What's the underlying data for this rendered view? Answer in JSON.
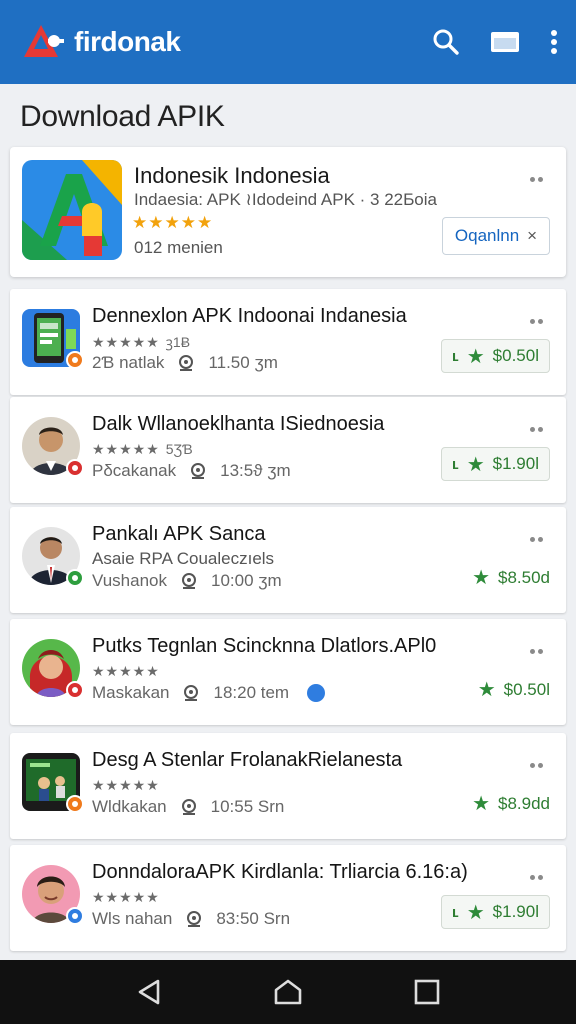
{
  "app": {
    "name": "firdonak"
  },
  "page": {
    "title": "Download APIK"
  },
  "featured": {
    "name": "Indonesik Indonesia",
    "subtitle": "Indaesia: APK ≀Idodeind APK · 3 22Ƃoia",
    "stars": "★★★★★",
    "count": "012 menien",
    "button_label": "Oqanlnn",
    "button_close": "×"
  },
  "items": [
    {
      "title": "Dennexlon APK Indoonai Indanesia",
      "stars": "★★★★★",
      "stars_sub": "ꝫ1Ƀ",
      "meta_left": "2Ɓ natlak",
      "meta_time": "11.50 ʒm",
      "price": "$0.50l",
      "price_style": "button",
      "badge_color": "#f07a1c",
      "avatar_kind": "phone"
    },
    {
      "title": "Dalk Wllanoeklhanta ISiednoesia",
      "stars": "★★★★★",
      "stars_sub": "5ƷƁ",
      "meta_left": "Pδcakanak",
      "meta_time": "13:5ϑ ʒm",
      "price": "$1.90l",
      "price_style": "button",
      "badge_color": "#d93030",
      "avatar_kind": "man"
    },
    {
      "title": "Pankalı APK Sanca",
      "subtitle": "Asaie RPA Coualeczıels",
      "meta_left": "Vushanok",
      "meta_time": "10:00 ʒm",
      "price": "$8.50d",
      "price_style": "plain",
      "badge_color": "#2e9e3e",
      "avatar_kind": "suit"
    },
    {
      "title": "Putks Tegnlan Scincknna Dlatlors.APl0",
      "stars": "★★★★★",
      "meta_left": "Maskakan",
      "meta_time": "18:20 tem",
      "extra_icon": "info-icon",
      "price": "$0.50l",
      "price_style": "plain",
      "badge_color": "#d93030",
      "avatar_kind": "girl"
    },
    {
      "title": "Desg A Stenlar FrolanakRielanesta",
      "stars": "★★★★★",
      "meta_left": "Wldkakan",
      "meta_time": "10:55 Srn",
      "price": "$8.9dd",
      "price_style": "plain",
      "badge_color": "#f07a1c",
      "avatar_kind": "screen"
    },
    {
      "title": "DonndaloraAPK Kirdlanla: Trliarcia 6.16:a)",
      "stars": "★★★★★",
      "meta_left": "Wls nahan",
      "meta_time": "83:50 Srn",
      "price": "$1.90l",
      "price_style": "button",
      "badge_color": "#2f7de0",
      "avatar_kind": "kid"
    }
  ],
  "price_prefix": "ʟ",
  "colors": {
    "topbar": "#1f6fc2",
    "price": "#2e7d32",
    "star": "#f2a20c"
  }
}
